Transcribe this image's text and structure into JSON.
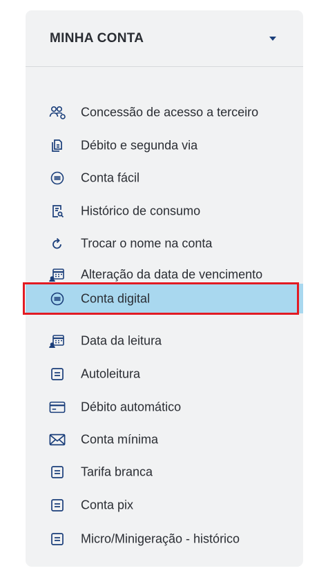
{
  "header": {
    "title": "MINHA CONTA",
    "caret_icon": "caret-down-icon"
  },
  "menu": {
    "selected_index": 6,
    "items": [
      {
        "label": "Concessão de acesso a terceiro",
        "icon": "users-icon"
      },
      {
        "label": "Débito e segunda via",
        "icon": "documents-icon"
      },
      {
        "label": "Conta fácil",
        "icon": "round-list-icon"
      },
      {
        "label": "Histórico de consumo",
        "icon": "document-search-icon"
      },
      {
        "label": "Trocar o nome na conta",
        "icon": "refresh-icon"
      },
      {
        "label": "Alteração da data de vencimento",
        "icon": "calendar-user-icon"
      },
      {
        "label": "Conta digital",
        "icon": "round-list-icon"
      },
      {
        "label": "Data da leitura",
        "icon": "calendar-user-icon"
      },
      {
        "label": "Autoleitura",
        "icon": "document-lines-icon"
      },
      {
        "label": "Débito automático",
        "icon": "credit-card-icon"
      },
      {
        "label": "Conta mínima",
        "icon": "envelope-icon"
      },
      {
        "label": "Tarifa branca",
        "icon": "document-lines-icon"
      },
      {
        "label": "Conta pix",
        "icon": "document-lines-icon"
      },
      {
        "label": "Micro/Minigeração - histórico",
        "icon": "document-lines-icon"
      }
    ]
  },
  "colors": {
    "icon": "#1a3e7a",
    "text": "#2a2d33",
    "selected_bg": "#a9d8ef",
    "highlight_border": "#e21b23",
    "card_bg": "#f1f2f3"
  }
}
